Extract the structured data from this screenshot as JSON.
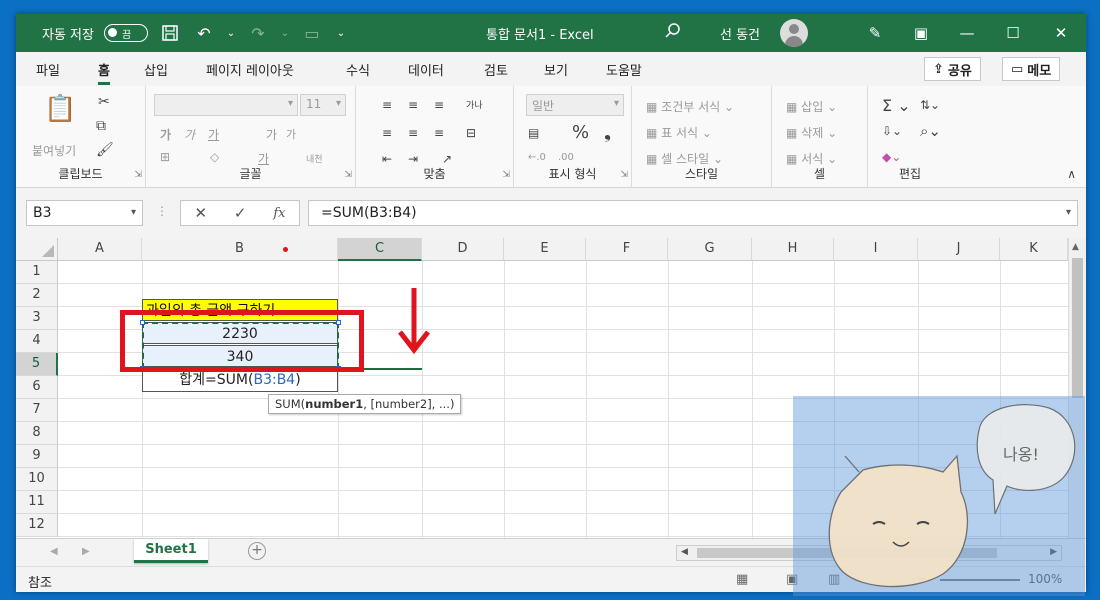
{
  "titlebar": {
    "autosave_label": "자동 저장",
    "autosave_state": "끔",
    "title": "통합 문서1  -  Excel",
    "user": "선 동건"
  },
  "tabs": [
    {
      "label": "파일"
    },
    {
      "label": "홈",
      "active": true
    },
    {
      "label": "삽입"
    },
    {
      "label": "페이지 레이아웃"
    },
    {
      "label": "수식"
    },
    {
      "label": "데이터"
    },
    {
      "label": "검토"
    },
    {
      "label": "보기"
    },
    {
      "label": "도움말"
    }
  ],
  "share_label": "공유",
  "memo_label": "메모",
  "ribbon": {
    "clipboard": {
      "label": "클립보드",
      "paste": "붙여넣기"
    },
    "font": {
      "label": "글꼴",
      "size": "11",
      "bold": "가",
      "italic": "가",
      "underline": "가",
      "grow": "가",
      "shrink": "가",
      "phonetic": "내천",
      "font_color": "가"
    },
    "align": {
      "label": "맞춤",
      "wrap": "가나"
    },
    "number": {
      "label": "표시 형식",
      "format": "일반"
    },
    "styles": {
      "label": "스타일",
      "conditional": "조건부 서식",
      "table": "표 서식",
      "cell": "셀 스타일"
    },
    "cells": {
      "label": "셀",
      "insert": "삽입",
      "delete": "삭제",
      "format": "서식"
    },
    "editing": {
      "label": "편집"
    }
  },
  "formula_bar": {
    "name_box": "B3",
    "fx": "fx",
    "formula": "=SUM(B3:B4)"
  },
  "grid": {
    "columns": [
      "A",
      "B",
      "C",
      "D",
      "E",
      "F",
      "G",
      "H",
      "I",
      "J",
      "K"
    ],
    "rows": [
      "1",
      "2",
      "3",
      "4",
      "5",
      "6",
      "7",
      "8",
      "9",
      "10",
      "11",
      "12"
    ],
    "title_cell": "과일의 총 금액 구하기",
    "b3": "2230",
    "b4": "340",
    "b5_prefix": "합계=SUM(",
    "b5_ref": "B3:B4",
    "b5_suffix": ")",
    "tooltip_prefix": "SUM(",
    "tooltip_bold": "number1",
    "tooltip_suffix": ", [number2], ...)"
  },
  "sheet": {
    "tab": "Sheet1"
  },
  "status": {
    "text": "참조",
    "zoom": "100%"
  },
  "overlay": {
    "speech": "나옹!"
  },
  "colors": {
    "excel_green": "#217346",
    "highlight_red": "#e0141d",
    "title_fill": "#ffff00",
    "ref_blue": "#2b66c7"
  }
}
